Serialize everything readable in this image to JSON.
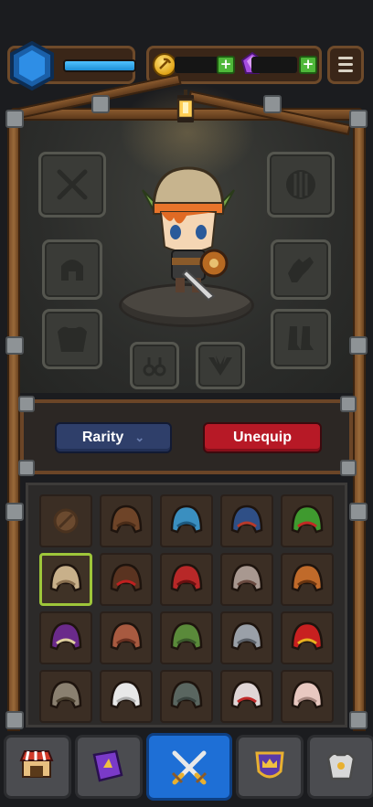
{
  "player": {
    "xp_progress": 1.0,
    "level_icon": "blue-hexagon-badge"
  },
  "currency": {
    "gold_icon": "pickaxe-coin-icon",
    "gem_icon": "purple-gem-icon",
    "add_symbol": "+"
  },
  "menu": {
    "icon": "hamburger-menu-icon"
  },
  "equipment_slots": {
    "left": [
      "weapon",
      "helmet",
      "armor"
    ],
    "right": [
      "shield",
      "gloves",
      "boots"
    ],
    "bottom": [
      "earrings",
      "wings"
    ]
  },
  "actions": {
    "rarity_label": "Rarity",
    "unequip_label": "Unequip"
  },
  "inventory": {
    "selected_index": 5,
    "items": [
      {
        "name": "empty-slot",
        "color": "#6b4a2f",
        "accent": "#4a321f"
      },
      {
        "name": "brown-acorn-cap",
        "color": "#6e4428",
        "accent": "#4a2c18"
      },
      {
        "name": "blue-hood",
        "color": "#3a8fc0",
        "accent": "#1d5a80"
      },
      {
        "name": "dark-hood",
        "color": "#2f4f86",
        "accent": "#b83a2a"
      },
      {
        "name": "green-feather-hat",
        "color": "#3f9a2f",
        "accent": "#c12a24"
      },
      {
        "name": "leather-cap",
        "color": "#c8b08a",
        "accent": "#8a7050"
      },
      {
        "name": "ninja-mask",
        "color": "#5a3320",
        "accent": "#c02020"
      },
      {
        "name": "red-hood",
        "color": "#b82828",
        "accent": "#6a1010"
      },
      {
        "name": "grey-hood",
        "color": "#a89890",
        "accent": "#6a4a40"
      },
      {
        "name": "orange-helm",
        "color": "#c06a2a",
        "accent": "#6a3510"
      },
      {
        "name": "purple-feather-hat",
        "color": "#6a2a8a",
        "accent": "#e0d0a0"
      },
      {
        "name": "aviator-cap",
        "color": "#a85a40",
        "accent": "#6a3020"
      },
      {
        "name": "green-goblin-helm",
        "color": "#5a8a3a",
        "accent": "#3a5a2a"
      },
      {
        "name": "steel-helmet",
        "color": "#9aa0a8",
        "accent": "#5a6068"
      },
      {
        "name": "red-gold-helm",
        "color": "#c82020",
        "accent": "#e8b020"
      },
      {
        "name": "horned-skull-helm",
        "color": "#8a8070",
        "accent": "#4a4030"
      },
      {
        "name": "chef-hat",
        "color": "#e8e8e8",
        "accent": "#b0b0b0"
      },
      {
        "name": "iron-knight-helm",
        "color": "#5a6660",
        "accent": "#3a4440"
      },
      {
        "name": "white-red-hood",
        "color": "#e0d6d6",
        "accent": "#c02a2a"
      },
      {
        "name": "pink-cap",
        "color": "#e8c8c0",
        "accent": "#a88880"
      }
    ]
  },
  "bottom_nav": {
    "active_index": 2,
    "tabs": [
      {
        "name": "shop",
        "icon": "shop-stall-icon"
      },
      {
        "name": "spellbook",
        "icon": "purple-book-icon"
      },
      {
        "name": "battle",
        "icon": "crossed-swords-icon"
      },
      {
        "name": "guild",
        "icon": "crown-shield-icon"
      },
      {
        "name": "equipment",
        "icon": "armor-icon"
      }
    ]
  }
}
